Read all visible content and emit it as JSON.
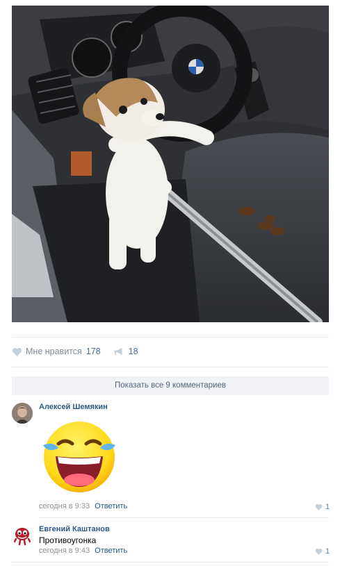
{
  "post": {
    "photo_icon": "dog-selfie-photo"
  },
  "actions": {
    "like_label": "Мне нравится",
    "like_count": "178",
    "share_count": "18",
    "like_icon": "heart-icon",
    "share_icon": "megaphone-icon"
  },
  "comments_bar": {
    "show_all_label": "Показать все 9 комментариев"
  },
  "comments": [
    {
      "author": "Алексей Шемякин",
      "sticker": "laughing-tears-emoji",
      "time": "сегодня в 9:33",
      "reply_label": "Ответить",
      "likes": "1"
    },
    {
      "author": "Евгений Каштанов",
      "text": "Противоугонка",
      "time": "сегодня в 9:43",
      "reply_label": "Ответить",
      "likes": "1"
    }
  ],
  "colors": {
    "link": "#2a5885",
    "muted": "#939393",
    "separator": "#e7e8ec",
    "bar_bg": "#f0f2f5"
  }
}
